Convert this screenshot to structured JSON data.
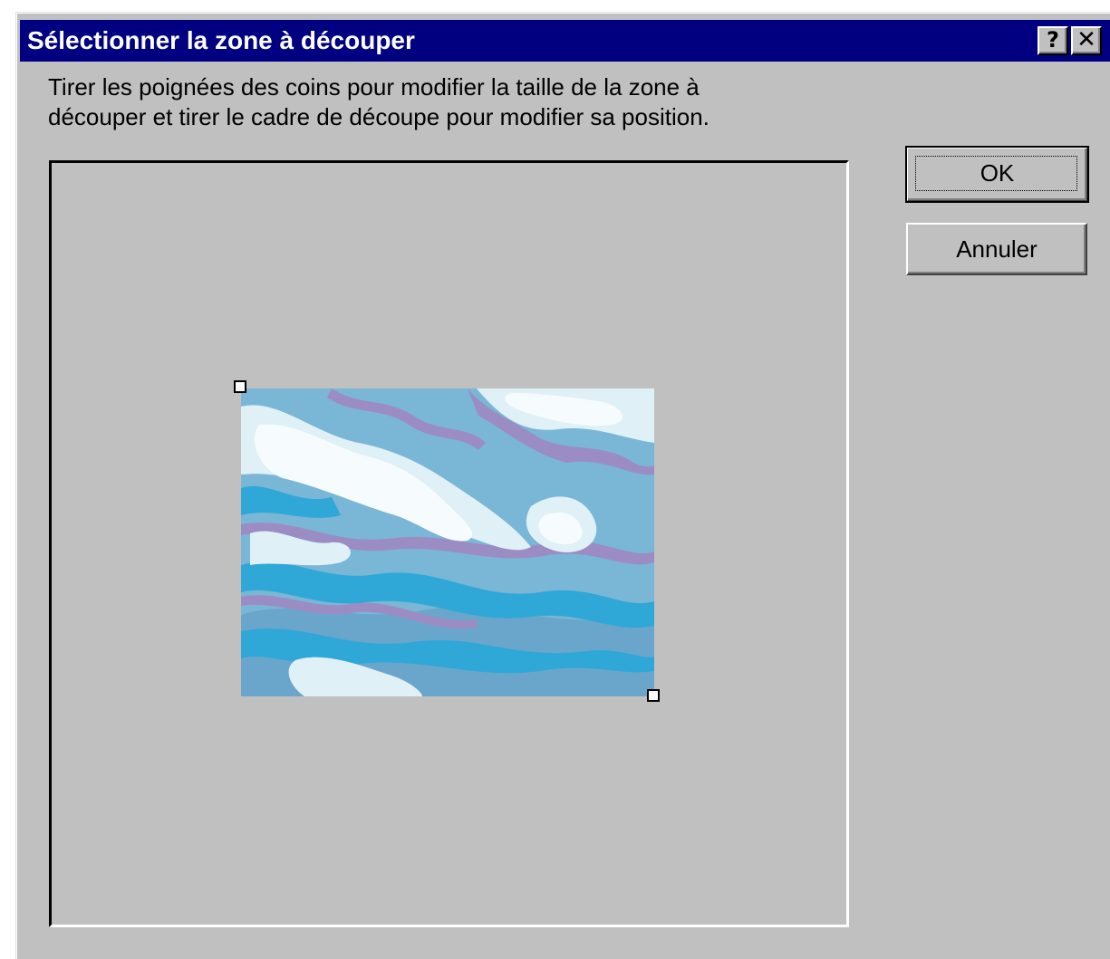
{
  "dialog": {
    "title": "Sélectionner la zone à découper",
    "help_glyph": "?",
    "close_glyph": "✕",
    "instruction_line1": "Tirer les poignées des coins pour modifier la taille de la zone à",
    "instruction_line2": "découper et tirer le cadre de découpe pour modifier sa position.",
    "ok_label": "OK",
    "cancel_label": "Annuler"
  },
  "colors": {
    "title_bar": "#000080",
    "face": "#c0c0c0",
    "image_base": "#7ab6d6",
    "image_cyan": "#2fa8d8",
    "image_purple": "#9c8cc4",
    "image_light": "#dff0f6",
    "image_white": "#f6fbfd"
  }
}
